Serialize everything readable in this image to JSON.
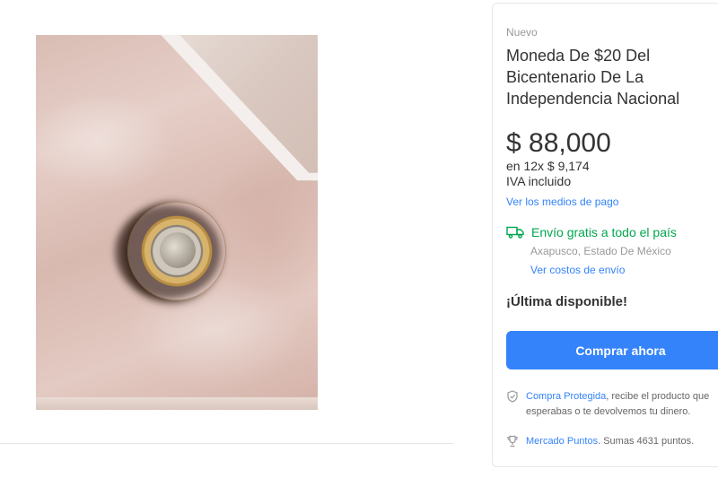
{
  "product": {
    "condition": "Nuevo",
    "title": "Moneda De $20 Del Bicentenario De La Independencia Nacional",
    "price": "$ 88,000",
    "installments": "en 12x $ 9,174",
    "tax_note": "IVA incluido",
    "payment_methods_link": "Ver los medios de pago"
  },
  "shipping": {
    "label": "Envío gratis a todo el país",
    "location": "Axapusco, Estado De México",
    "costs_link": "Ver costos de envío",
    "icon": "truck-icon"
  },
  "stock": {
    "label": "¡Última disponible!"
  },
  "actions": {
    "buy_now": "Comprar ahora"
  },
  "benefits": [
    {
      "icon": "shield-check-icon",
      "link": "Compra Protegida",
      "text": ", recibe el producto que",
      "text_line2": "esperabas o te devolvemos tu dinero."
    },
    {
      "icon": "trophy-icon",
      "link": "Mercado Puntos",
      "text": ". Sumas 4631 puntos."
    }
  ],
  "colors": {
    "accent": "#3483fa",
    "shipping_green": "#00a650"
  }
}
